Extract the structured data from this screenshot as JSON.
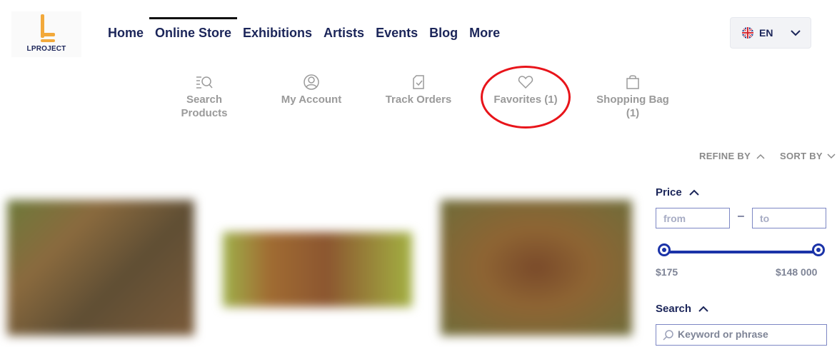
{
  "brand": {
    "name": "LPROJECT",
    "accent": "#f2a93b"
  },
  "nav": {
    "items": [
      {
        "label": "Home"
      },
      {
        "label": "Online Store"
      },
      {
        "label": "Exhibitions"
      },
      {
        "label": "Artists"
      },
      {
        "label": "Events"
      },
      {
        "label": "Blog"
      },
      {
        "label": "More"
      }
    ],
    "active": "Online Store"
  },
  "language": {
    "code": "EN",
    "flag_icon": "uk-flag-icon"
  },
  "utility": {
    "search": {
      "label_line1": "Search",
      "label_line2": "Products",
      "icon": "search-list-icon"
    },
    "account": {
      "label": "My Account",
      "icon": "user-circle-icon"
    },
    "orders": {
      "label": "Track Orders",
      "icon": "clipboard-check-icon"
    },
    "favorites": {
      "label": "Favorites (1)",
      "icon": "heart-icon"
    },
    "bag": {
      "label_line1": "Shopping Bag",
      "label_line2": "(1)",
      "icon": "shopping-bag-icon"
    }
  },
  "annotation": {
    "color": "#e8141a"
  },
  "toolbar": {
    "refine_label": "REFINE BY",
    "sort_label": "SORT BY"
  },
  "filters": {
    "price": {
      "title": "Price",
      "from_placeholder": "from",
      "to_placeholder": "to",
      "separator": "–",
      "min_label": "$175",
      "max_label": "$148 000"
    },
    "search": {
      "title": "Search",
      "placeholder": "Keyword or phrase"
    }
  },
  "colors": {
    "navy": "#1b2559",
    "slider": "#1b33a8",
    "muted": "#9a9a9a"
  }
}
